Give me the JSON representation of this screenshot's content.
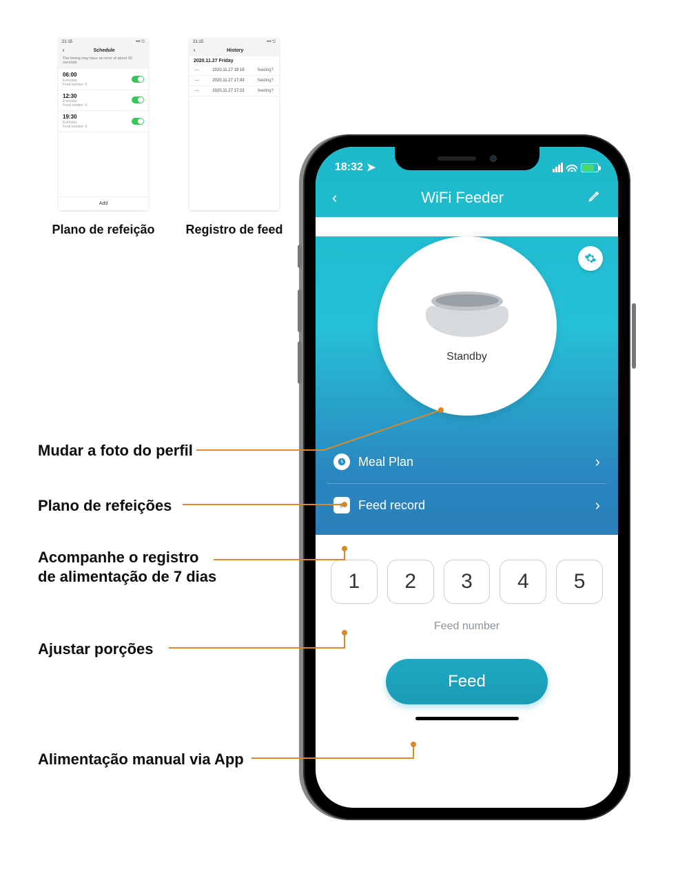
{
  "thumbnails": {
    "schedule": {
      "status_time": "21:15",
      "title": "Schedule",
      "note": "The timing may have an error of about 30 seconds",
      "rows": [
        {
          "time": "06:00",
          "line1": "Everyday",
          "line2": "Feed number: 6"
        },
        {
          "time": "12:30",
          "line1": "Everyday",
          "line2": "Feed number: 6"
        },
        {
          "time": "19:30",
          "line1": "Everyday",
          "line2": "Feed number: 6"
        }
      ],
      "add_label": "Add",
      "caption": "Plano de refeição"
    },
    "history": {
      "status_time": "21:15",
      "title": "History",
      "date": "2020.11.27 Friday",
      "rows": [
        {
          "ts": "2020.11.27 19:16",
          "status": "feeding?"
        },
        {
          "ts": "2020.11.27 17:43",
          "status": "feeding?"
        },
        {
          "ts": "2020.11.27 17:23",
          "status": "feeding?"
        }
      ],
      "caption": "Registro de feed"
    }
  },
  "phone": {
    "status_time": "18:32",
    "header_title": "WiFi Feeder",
    "standby_label": "Standby",
    "menu": {
      "meal_plan": "Meal Plan",
      "feed_record": "Feed record"
    },
    "portions": [
      "1",
      "2",
      "3",
      "4",
      "5"
    ],
    "feed_number_label": "Feed number",
    "feed_button": "Feed"
  },
  "callouts": {
    "profile": "Mudar a foto do perfil",
    "meal_plan": "Plano de refeições",
    "feed_record": "Acompanhe o registro de alimentação de 7 dias",
    "portions": "Ajustar porções",
    "manual_feed": "Alimentação manual via App"
  }
}
